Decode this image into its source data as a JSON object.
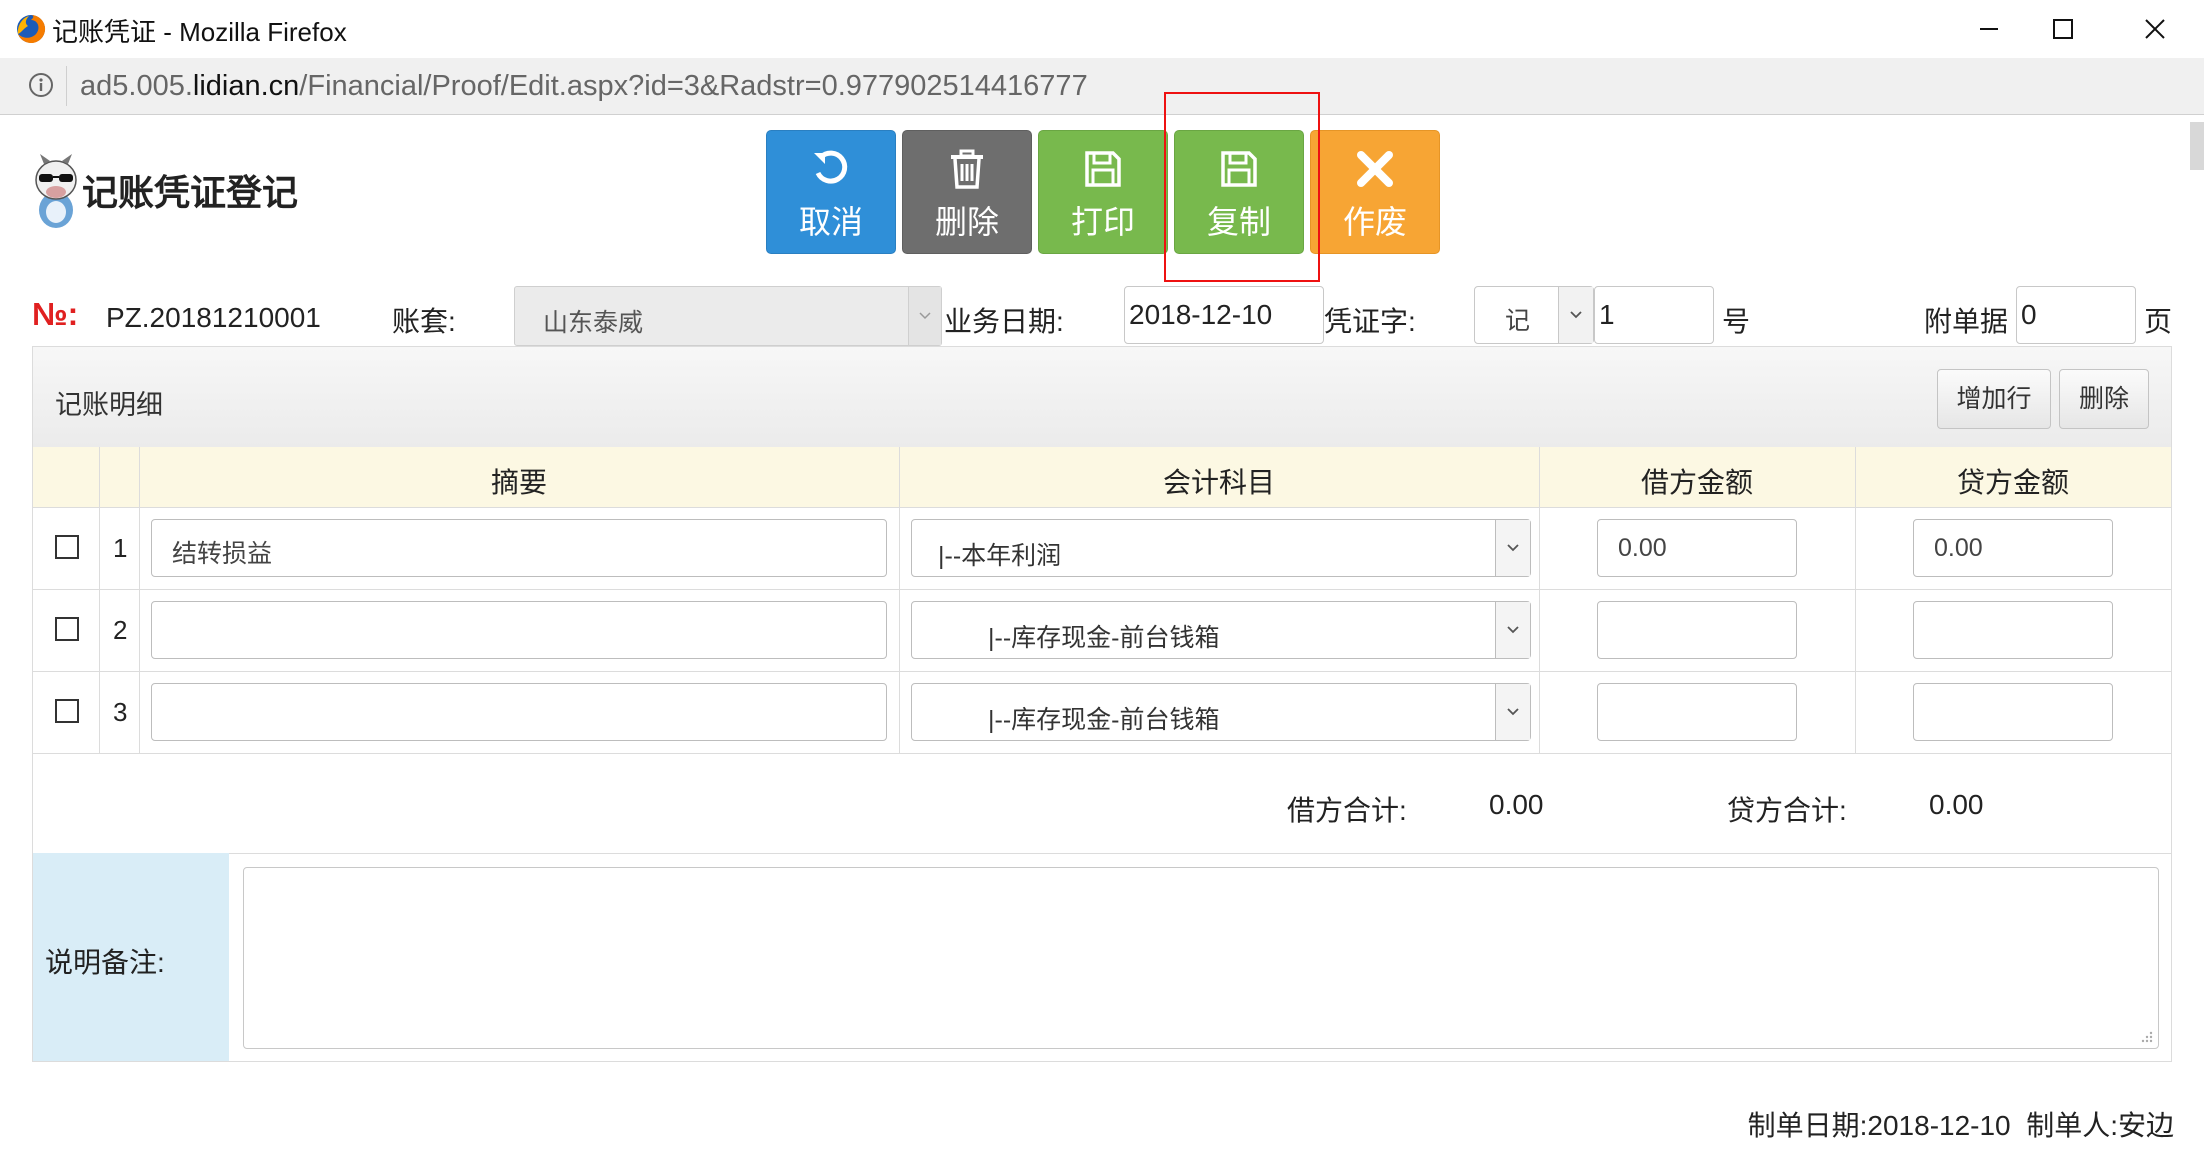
{
  "browser": {
    "window_title": "记账凭证 - Mozilla Firefox",
    "url_prefix": "ad5.005.",
    "url_host": "lidian.cn",
    "url_path": "/Financial/Proof/Edit.aspx?id=3&Radstr=0.977902514416777"
  },
  "app": {
    "title": "记账凭证登记"
  },
  "toolbar": {
    "cancel_label": "取消",
    "delete_label": "删除",
    "print_label": "打印",
    "copy_label": "复制",
    "void_label": "作废"
  },
  "header": {
    "no_label": "№:",
    "no_value": "PZ.20181210001",
    "account_label": "账套:",
    "account_value": "山东泰威",
    "date_label": "业务日期:",
    "date_value": "2018-12-10",
    "voucher_label": "凭证字:",
    "voucher_type": "记",
    "voucher_number": "1",
    "number_suffix": "号",
    "attach_label": "附单据",
    "attach_value": "0",
    "attach_suffix": "页"
  },
  "panel": {
    "title": "记账明细",
    "add_row_label": "增加行",
    "delete_label": "删除"
  },
  "columns": {
    "summary": "摘要",
    "subject": "会计科目",
    "debit": "借方金额",
    "credit": "贷方金额"
  },
  "rows": [
    {
      "num": "1",
      "summary": "结转损益",
      "subject": "|--本年利润",
      "debit": "0.00",
      "credit": "0.00"
    },
    {
      "num": "2",
      "summary": "",
      "subject": "|--库存现金-前台钱箱",
      "debit": "",
      "credit": ""
    },
    {
      "num": "3",
      "summary": "",
      "subject": "|--库存现金-前台钱箱",
      "debit": "",
      "credit": ""
    }
  ],
  "totals": {
    "debit_label": "借方合计:",
    "debit_value": "0.00",
    "credit_label": "贷方合计:",
    "credit_value": "0.00"
  },
  "memo": {
    "label": "说明备注:",
    "value": ""
  },
  "footer": {
    "made_date_label": "制单日期:",
    "made_date_value": "2018-12-10",
    "maker_label": "制单人:",
    "maker_value": "安边"
  },
  "colors": {
    "cancel": "#2f8fd8",
    "delete": "#6e6e6e",
    "print": "#78b94d",
    "copy": "#78b94d",
    "void": "#f7a534",
    "highlight": "#ee1111"
  }
}
